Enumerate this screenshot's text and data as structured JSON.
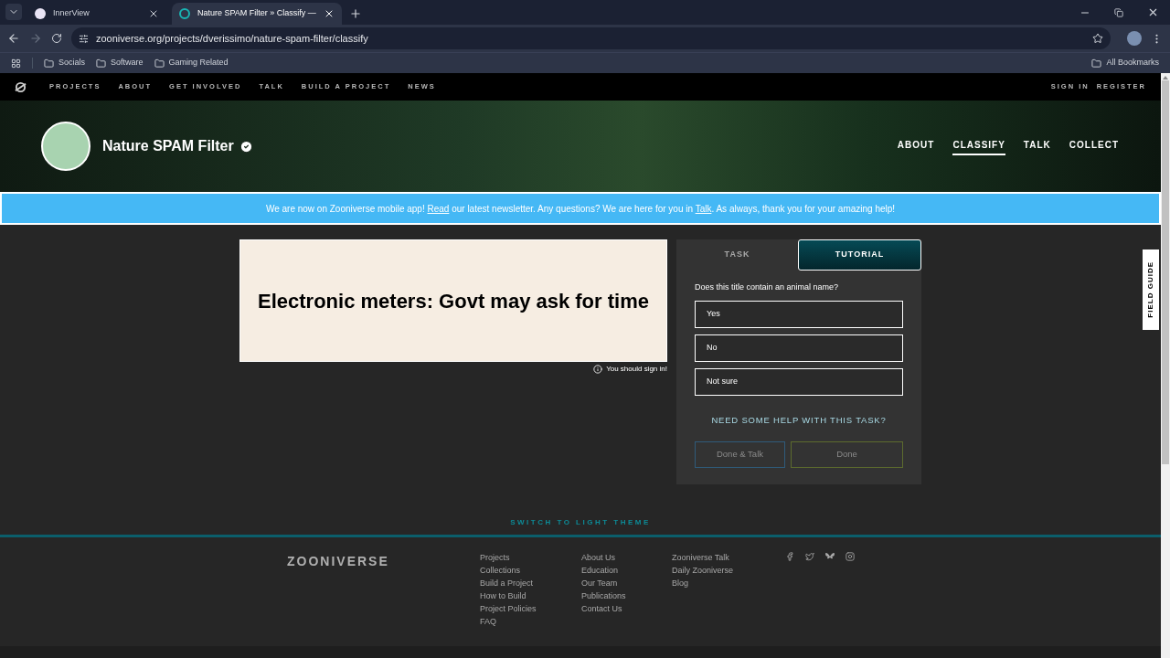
{
  "browser": {
    "tabs": [
      {
        "title": "InnerView",
        "selected": false
      },
      {
        "title": "Nature SPAM Filter » Classify —",
        "selected": true
      }
    ],
    "url": "zooniverse.org/projects/dverissimo/nature-spam-filter/classify",
    "bookmarks": [
      "Socials",
      "Software",
      "Gaming Related"
    ],
    "all_bookmarks": "All Bookmarks"
  },
  "site_nav": {
    "links": [
      "PROJECTS",
      "ABOUT",
      "GET INVOLVED",
      "TALK",
      "BUILD A PROJECT",
      "NEWS"
    ],
    "account": [
      "SIGN IN",
      "REGISTER"
    ]
  },
  "project": {
    "title": "Nature SPAM Filter",
    "verified": true,
    "nav": [
      {
        "label": "ABOUT",
        "selected": false
      },
      {
        "label": "CLASSIFY",
        "selected": true
      },
      {
        "label": "TALK",
        "selected": false
      },
      {
        "label": "COLLECT",
        "selected": false
      }
    ]
  },
  "banner": {
    "parts": [
      {
        "kind": "text",
        "text": "We are now on Zooniverse mobile app! "
      },
      {
        "kind": "link",
        "text": "Read"
      },
      {
        "kind": "text",
        "text": " our latest newsletter. Any questions? We are here for you in "
      },
      {
        "kind": "link",
        "text": "Talk"
      },
      {
        "kind": "text",
        "text": ". As always, thank you for your amazing help!"
      }
    ]
  },
  "subject": {
    "text": "Electronic meters: Govt may ask for time",
    "notice": "You should sign in!"
  },
  "task_panel": {
    "tabs": [
      {
        "label": "TASK",
        "selected": false
      },
      {
        "label": "TUTORIAL",
        "selected": true
      }
    ],
    "question": "Does this title contain an animal name?",
    "answers": [
      {
        "label": "Yes",
        "selected": false
      },
      {
        "label": "No",
        "selected": false
      },
      {
        "label": "Not sure",
        "selected": false
      }
    ],
    "help_link": "NEED SOME HELP WITH THIS TASK?",
    "buttons": [
      {
        "label": "Done & Talk",
        "disabled": true
      },
      {
        "label": "Done",
        "disabled": true
      }
    ]
  },
  "field_guide": "FIELD GUIDE",
  "theme_toggle": "SWITCH TO LIGHT THEME",
  "footer": {
    "logo": "ZOONIVERSE",
    "columns": [
      [
        "Projects",
        "Collections",
        "Build a Project",
        "How to Build",
        "Project Policies",
        "FAQ"
      ],
      [
        "About Us",
        "Education",
        "Our Team",
        "Publications",
        "Contact Us"
      ],
      [
        "Zooniverse Talk",
        "Daily Zooniverse",
        "Blog"
      ]
    ]
  }
}
